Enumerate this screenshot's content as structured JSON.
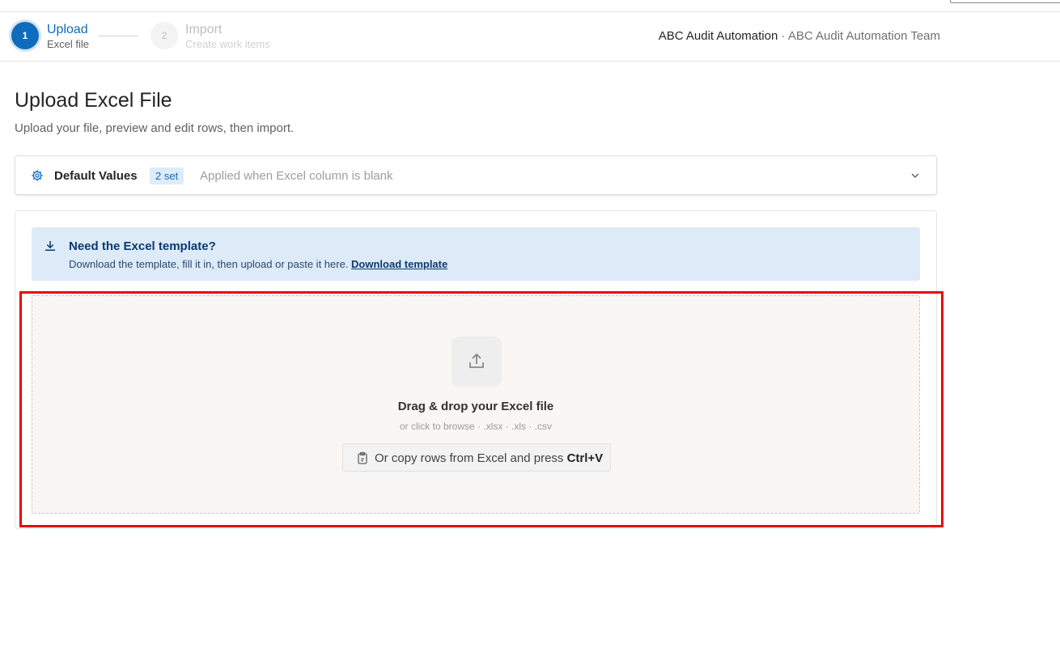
{
  "steps": [
    {
      "number": "1",
      "title": "Upload",
      "subtitle": "Excel file"
    },
    {
      "number": "2",
      "title": "Import",
      "subtitle": "Create work items"
    }
  ],
  "header": {
    "app_name": "ABC Audit Automation",
    "separator": " · ",
    "team": "ABC Audit Automation Team"
  },
  "page": {
    "title": "Upload Excel File",
    "subtitle": "Upload your file, preview and edit rows, then import."
  },
  "defaults_panel": {
    "icon": "gear-icon",
    "title": "Default Values",
    "badge": "2 set",
    "hint": "Applied when Excel column is blank",
    "expand_icon": "chevron-down-icon"
  },
  "template_notice": {
    "icon": "download-icon",
    "title": "Need the Excel template?",
    "text": "Download the template, fill it in, then upload or paste it here. ",
    "link": "Download template"
  },
  "dropzone": {
    "icon": "upload-icon",
    "title": "Drag & drop your Excel file",
    "subtitle": "or click to browse · .xlsx · .xls · .csv",
    "paste_icon": "clipboard-icon",
    "paste_text": "Or copy rows from Excel and press ",
    "paste_shortcut": "Ctrl+V"
  },
  "colors": {
    "accent": "#0f6cbd",
    "info_bg": "#ddeaf8",
    "highlight": "#ee0000"
  }
}
